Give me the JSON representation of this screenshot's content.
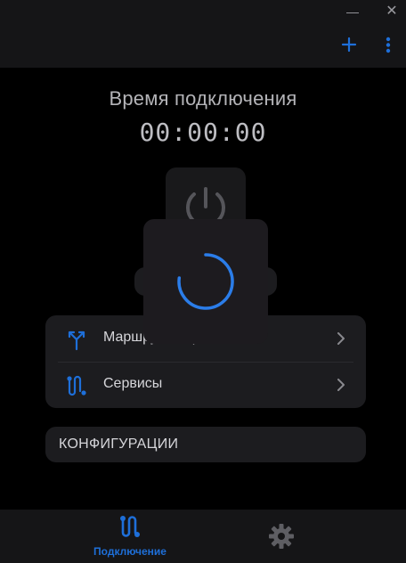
{
  "window": {
    "minimize_glyph": "—",
    "close_glyph": "✕"
  },
  "header": {
    "add_icon": "plus-icon",
    "menu_icon": "more-vertical-icon"
  },
  "main": {
    "time_label": "Время подключения",
    "timer": "00:00:00",
    "power_icon": "power-icon"
  },
  "nav": {
    "items": [
      {
        "label": "Маршрутизация",
        "icon": "routing-icon"
      },
      {
        "label": "Сервисы",
        "icon": "services-icon"
      }
    ]
  },
  "config": {
    "label": "КОНФИГУРАЦИИ"
  },
  "loading": {
    "icon": "spinner-icon"
  },
  "bottom_nav": {
    "tabs": [
      {
        "label": "Подключение",
        "icon": "connection-icon",
        "active": true
      },
      {
        "label": "",
        "icon": "gear-icon",
        "active": false
      }
    ]
  },
  "colors": {
    "accent": "#1e6fd9",
    "background": "#000000",
    "surface": "#1c1c1f",
    "overlay": "#1d1b1f"
  }
}
